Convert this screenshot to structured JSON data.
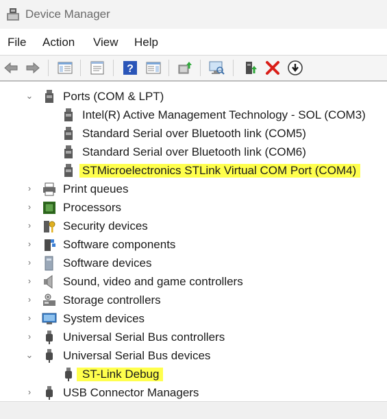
{
  "window": {
    "title": "Device Manager"
  },
  "menu": {
    "file": "File",
    "action": "Action",
    "view": "View",
    "help": "Help"
  },
  "toolbar": {
    "buttons": [
      "back-icon",
      "forward-icon",
      "show-hide-tree-icon",
      "properties-icon",
      "help-icon",
      "console-tree-icon",
      "update-driver-icon",
      "scan-hardware-icon",
      "enable-device-icon",
      "uninstall-device-icon",
      "download-icon"
    ]
  },
  "tree": {
    "ports": {
      "label": "Ports (COM & LPT)",
      "children": [
        "Intel(R) Active Management Technology - SOL (COM3)",
        "Standard Serial over Bluetooth link (COM5)",
        "Standard Serial over Bluetooth link (COM6)",
        "STMicroelectronics STLink Virtual COM Port (COM4)"
      ]
    },
    "print_queues": "Print queues",
    "processors": "Processors",
    "security_devices": "Security devices",
    "software_components": "Software components",
    "software_devices": "Software devices",
    "sound": "Sound, video and game controllers",
    "storage": "Storage controllers",
    "system_devices": "System devices",
    "usb_controllers": "Universal Serial Bus controllers",
    "usb_devices": {
      "label": "Universal Serial Bus devices",
      "children": [
        "ST-Link Debug"
      ]
    },
    "usb_connector": "USB Connector Managers"
  },
  "colors": {
    "highlight": "#ffff4d",
    "uninstall_red": "#d91e18",
    "help_blue": "#2a55b8"
  }
}
